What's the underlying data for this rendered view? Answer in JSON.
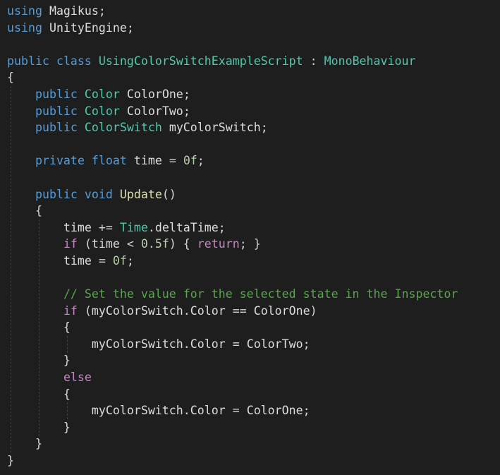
{
  "lines": [
    [
      {
        "t": "using",
        "c": "kw"
      },
      {
        "t": " "
      },
      {
        "t": "Magikus",
        "c": "id"
      },
      {
        "t": ";"
      }
    ],
    [
      {
        "t": "using",
        "c": "kw"
      },
      {
        "t": " "
      },
      {
        "t": "UnityEngine",
        "c": "id"
      },
      {
        "t": ";"
      }
    ],
    [],
    [
      {
        "t": "public",
        "c": "kw"
      },
      {
        "t": " "
      },
      {
        "t": "class",
        "c": "kw"
      },
      {
        "t": " "
      },
      {
        "t": "UsingColorSwitchExampleScript",
        "c": "ty"
      },
      {
        "t": " : "
      },
      {
        "t": "MonoBehaviour",
        "c": "ty"
      }
    ],
    [
      {
        "t": "{"
      }
    ],
    [
      {
        "t": "    "
      },
      {
        "t": "public",
        "c": "kw"
      },
      {
        "t": " "
      },
      {
        "t": "Color",
        "c": "ty"
      },
      {
        "t": " "
      },
      {
        "t": "ColorOne",
        "c": "id"
      },
      {
        "t": ";"
      }
    ],
    [
      {
        "t": "    "
      },
      {
        "t": "public",
        "c": "kw"
      },
      {
        "t": " "
      },
      {
        "t": "Color",
        "c": "ty"
      },
      {
        "t": " "
      },
      {
        "t": "ColorTwo",
        "c": "id"
      },
      {
        "t": ";"
      }
    ],
    [
      {
        "t": "    "
      },
      {
        "t": "public",
        "c": "kw"
      },
      {
        "t": " "
      },
      {
        "t": "ColorSwitch",
        "c": "ty"
      },
      {
        "t": " "
      },
      {
        "t": "myColorSwitch",
        "c": "id"
      },
      {
        "t": ";"
      }
    ],
    [],
    [
      {
        "t": "    "
      },
      {
        "t": "private",
        "c": "kw"
      },
      {
        "t": " "
      },
      {
        "t": "float",
        "c": "kw"
      },
      {
        "t": " "
      },
      {
        "t": "time",
        "c": "id"
      },
      {
        "t": " = "
      },
      {
        "t": "0f",
        "c": "num"
      },
      {
        "t": ";"
      }
    ],
    [],
    [
      {
        "t": "    "
      },
      {
        "t": "public",
        "c": "kw"
      },
      {
        "t": " "
      },
      {
        "t": "void",
        "c": "kw"
      },
      {
        "t": " "
      },
      {
        "t": "Update",
        "c": "fn"
      },
      {
        "t": "()"
      }
    ],
    [
      {
        "t": "    {"
      }
    ],
    [
      {
        "t": "        "
      },
      {
        "t": "time",
        "c": "id"
      },
      {
        "t": " += "
      },
      {
        "t": "Time",
        "c": "ty"
      },
      {
        "t": "."
      },
      {
        "t": "deltaTime",
        "c": "id"
      },
      {
        "t": ";"
      }
    ],
    [
      {
        "t": "        "
      },
      {
        "t": "if",
        "c": "ctl"
      },
      {
        "t": " ("
      },
      {
        "t": "time",
        "c": "id"
      },
      {
        "t": " < "
      },
      {
        "t": "0.5f",
        "c": "num"
      },
      {
        "t": ") { "
      },
      {
        "t": "return",
        "c": "ctl"
      },
      {
        "t": "; }"
      }
    ],
    [
      {
        "t": "        "
      },
      {
        "t": "time",
        "c": "id"
      },
      {
        "t": " = "
      },
      {
        "t": "0f",
        "c": "num"
      },
      {
        "t": ";"
      }
    ],
    [],
    [
      {
        "t": "        "
      },
      {
        "t": "// Set the value for the selected state in the Inspector",
        "c": "cmt"
      }
    ],
    [
      {
        "t": "        "
      },
      {
        "t": "if",
        "c": "ctl"
      },
      {
        "t": " ("
      },
      {
        "t": "myColorSwitch",
        "c": "id"
      },
      {
        "t": "."
      },
      {
        "t": "Color",
        "c": "id"
      },
      {
        "t": " == "
      },
      {
        "t": "ColorOne",
        "c": "id"
      },
      {
        "t": ")"
      }
    ],
    [
      {
        "t": "        {"
      }
    ],
    [
      {
        "t": "            "
      },
      {
        "t": "myColorSwitch",
        "c": "id"
      },
      {
        "t": "."
      },
      {
        "t": "Color",
        "c": "id"
      },
      {
        "t": " = "
      },
      {
        "t": "ColorTwo",
        "c": "id"
      },
      {
        "t": ";"
      }
    ],
    [
      {
        "t": "        }"
      }
    ],
    [
      {
        "t": "        "
      },
      {
        "t": "else",
        "c": "ctl"
      }
    ],
    [
      {
        "t": "        {"
      }
    ],
    [
      {
        "t": "            "
      },
      {
        "t": "myColorSwitch",
        "c": "id"
      },
      {
        "t": "."
      },
      {
        "t": "Color",
        "c": "id"
      },
      {
        "t": " = "
      },
      {
        "t": "ColorOne",
        "c": "id"
      },
      {
        "t": ";"
      }
    ],
    [
      {
        "t": "        }"
      }
    ],
    [
      {
        "t": "    }"
      }
    ],
    [
      {
        "t": "}"
      }
    ]
  ],
  "guides": [
    {
      "col": 0,
      "from": 5,
      "to": 27
    },
    {
      "col": 4,
      "from": 13,
      "to": 26
    },
    {
      "col": 8,
      "from": 20,
      "to": 21
    },
    {
      "col": 8,
      "from": 24,
      "to": 25
    }
  ]
}
